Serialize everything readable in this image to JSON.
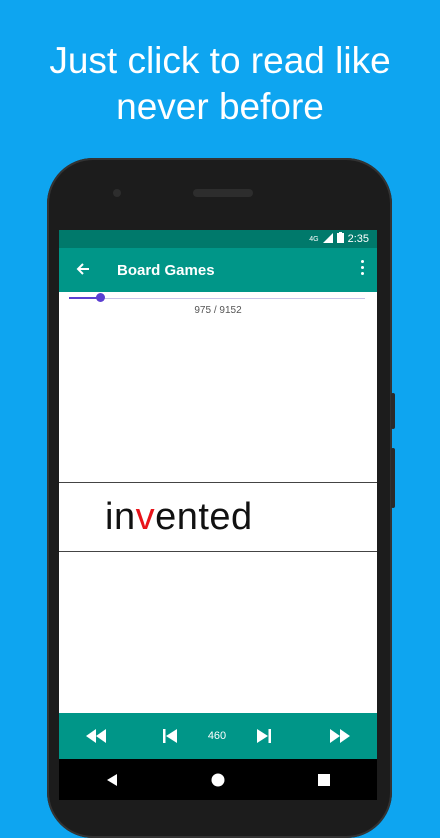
{
  "promo": {
    "headline_line1": "Just click to read like",
    "headline_line2": "never before"
  },
  "status_bar": {
    "network": "4G",
    "time": "2:35"
  },
  "app_bar": {
    "title": "Board Games",
    "back_icon": "arrow-back-icon",
    "menu_icon": "more-vert-icon"
  },
  "progress": {
    "current": 975,
    "total": 9152,
    "label": "975 / 9152",
    "fraction": 0.107
  },
  "reader": {
    "word_before": "in",
    "word_focus": "v",
    "word_after": "ented"
  },
  "controls": {
    "rewind_icon": "fast-rewind-icon",
    "prev_icon": "skip-previous-icon",
    "speed": "460",
    "next_icon": "skip-next-icon",
    "forward_icon": "fast-forward-icon"
  },
  "colors": {
    "background": "#0ea5f0",
    "app_bar": "#009688",
    "status_bar": "#00796b",
    "progress": "#5b3fd1",
    "focus_letter": "#e8141a"
  }
}
